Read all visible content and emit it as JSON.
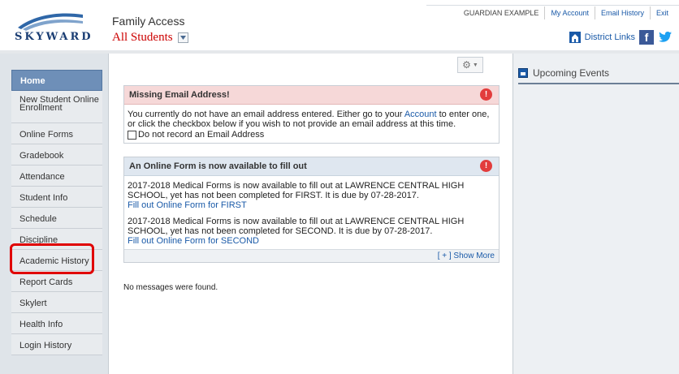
{
  "header": {
    "logo_text": "SKYWARD",
    "app_title": "Family Access",
    "student_selector": "All Students",
    "user_name": "GUARDIAN EXAMPLE",
    "links": [
      "My Account",
      "Email History",
      "Exit"
    ],
    "district_links": "District Links",
    "icons": [
      "district-icon",
      "facebook-icon",
      "twitter-icon"
    ]
  },
  "sidebar": {
    "items": [
      "Home",
      "New Student Online Enrollment",
      "Online Forms",
      "Gradebook",
      "Attendance",
      "Student Info",
      "Schedule",
      "Discipline",
      "Academic History",
      "Report Cards",
      "Skylert",
      "Health Info",
      "Login History"
    ],
    "highlighted": "Student Info"
  },
  "email_panel": {
    "title": "Missing Email Address!",
    "text_before": "You currently do not have an email address entered. Either go to your ",
    "account_link": "Account",
    "text_after": " to enter one, or click the checkbox below if you wish to not provide an email address at this time.",
    "checkbox_label": "Do not record an Email Address"
  },
  "forms_panel": {
    "title": "An Online Form is now available to fill out",
    "forms": [
      {
        "text": "2017-2018 Medical Forms is now available to fill out at LAWRENCE CENTRAL HIGH SCHOOL, yet has not been completed for FIRST.  It is due by 07-28-2017.",
        "link": "Fill out Online Form for FIRST"
      },
      {
        "text": "2017-2018 Medical Forms is now available to fill out at LAWRENCE CENTRAL HIGH SCHOOL, yet has not been completed for SECOND.  It is due by 07-28-2017.",
        "link": "Fill out Online Form for SECOND"
      }
    ],
    "show_more": "[ + ] Show More"
  },
  "no_messages": "No messages were found.",
  "events": {
    "title": "Upcoming Events"
  },
  "colors": {
    "nav_home_bg": "#6e8fb8",
    "highlight_border": "#e00000",
    "link": "#1a5aa8",
    "alert_red": "#e23c3c"
  }
}
